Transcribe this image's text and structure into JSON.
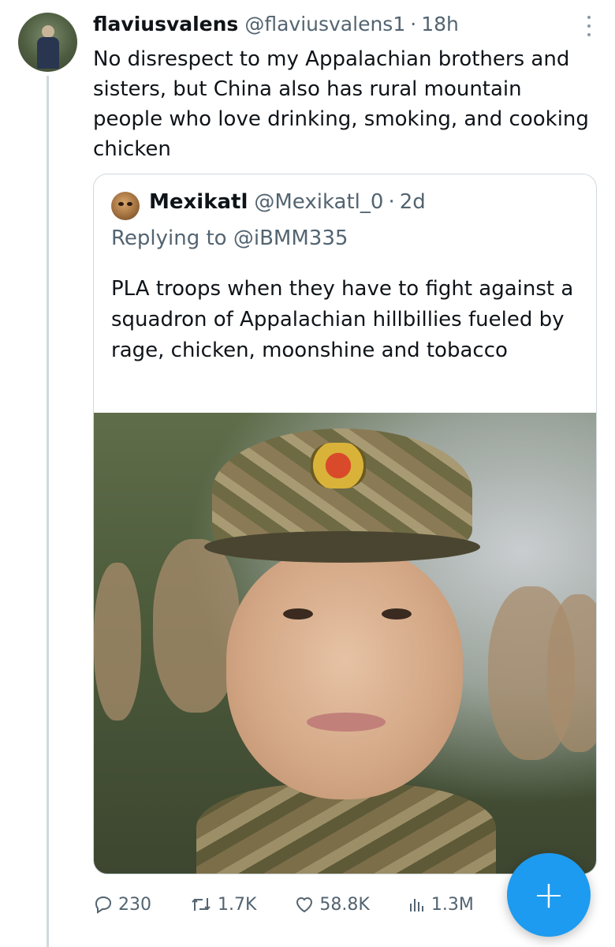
{
  "tweet": {
    "author_name": "flaviusvalens",
    "author_handle": "@flaviusvalens1",
    "separator": "·",
    "time": "18h",
    "text": "No disrespect to my Appalachian brothers and sisters, but China also has rural mountain people who love drinking, smoking, and cooking chicken"
  },
  "quoted_tweet": {
    "author_name": "Mexikatl",
    "author_handle": "@Mexikatl_0",
    "separator": "·",
    "time": "2d",
    "replying_prefix": "Replying to",
    "replying_to": "@iBMM335",
    "text": "PLA troops when they have to fight against a squadron of Appalachian hillbillies fueled by rage, chicken, moonshine and tobacco"
  },
  "actions": {
    "replies": "230",
    "retweets": "1.7K",
    "likes": "58.8K",
    "views": "1.3M"
  },
  "fab": {
    "label": "+"
  },
  "colors": {
    "accent": "#1d9bf0",
    "muted_text": "#536471",
    "border": "#cfd9de"
  }
}
